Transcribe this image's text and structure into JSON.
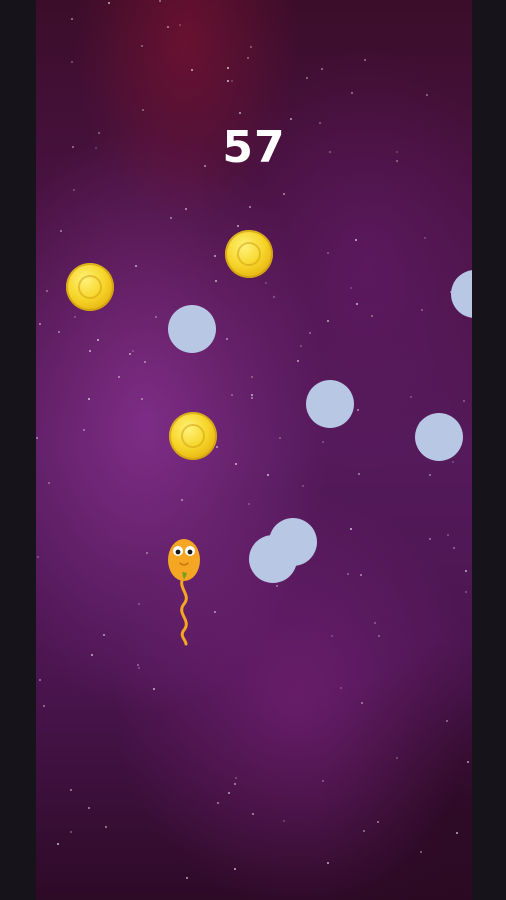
{
  "game": {
    "score": "57"
  },
  "colors": {
    "bubble": "#b8c7e4",
    "coin": "#f7d62a",
    "player": "#f5a623"
  },
  "entities": {
    "player": {
      "icon": "sperm-character-icon"
    },
    "coins": [
      {
        "icon": "gold-coin-icon"
      },
      {
        "icon": "gold-coin-icon"
      },
      {
        "icon": "gold-coin-icon"
      }
    ],
    "bubbles": [
      {
        "icon": "egg-bubble-icon"
      },
      {
        "icon": "egg-bubble-icon"
      },
      {
        "icon": "egg-bubble-icon"
      },
      {
        "icon": "egg-bubble-icon"
      },
      {
        "icon": "egg-bubble-icon"
      },
      {
        "icon": "egg-bubble-icon"
      }
    ]
  }
}
